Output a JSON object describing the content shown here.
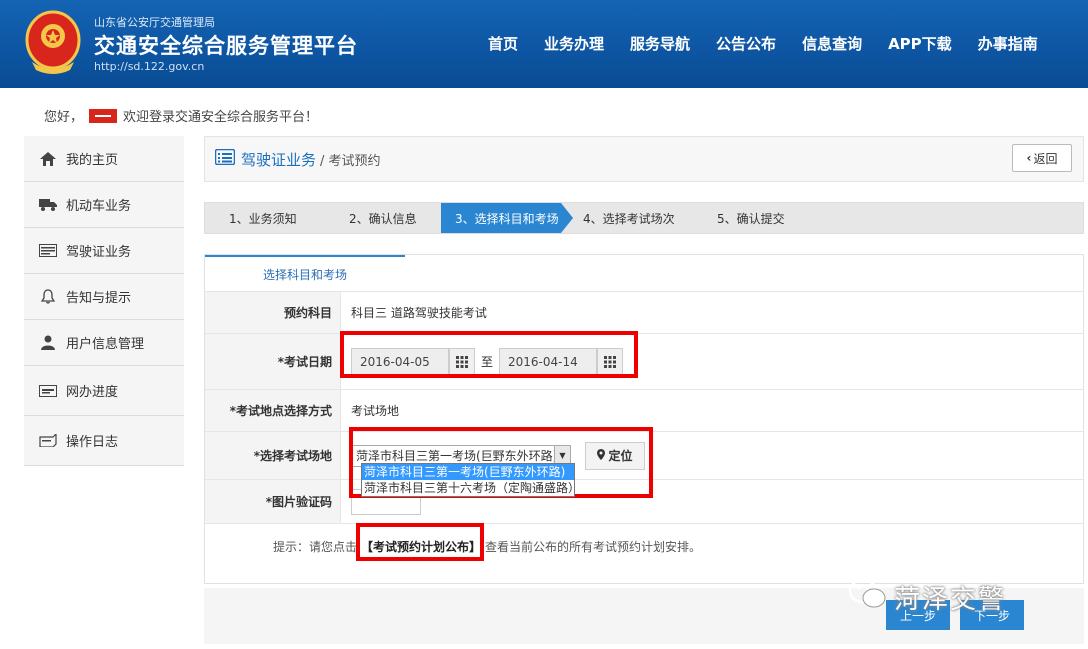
{
  "header": {
    "org": "山东省公安厅交通管理局",
    "title": "交通安全综合服务管理平台",
    "url": "http://sd.122.gov.cn",
    "nav": [
      "首页",
      "业务办理",
      "服务导航",
      "公告公布",
      "信息查询",
      "APP下载",
      "办事指南"
    ]
  },
  "greeting": {
    "prefix": "您好，",
    "suffix": "欢迎登录交通安全综合服务平台！"
  },
  "sidebar": {
    "items": [
      {
        "label": "我的主页",
        "icon": "home-icon"
      },
      {
        "label": "机动车业务",
        "icon": "truck-icon"
      },
      {
        "label": "驾驶证业务",
        "icon": "license-card-icon"
      },
      {
        "label": "告知与提示",
        "icon": "bell-icon"
      },
      {
        "label": "用户信息管理",
        "icon": "user-icon"
      },
      {
        "label": "网办进度",
        "icon": "progress-icon"
      },
      {
        "label": "操作日志",
        "icon": "log-icon"
      }
    ]
  },
  "breadcrumb": {
    "main": "驾驶证业务",
    "sub": "/ 考试预约",
    "back_label": "返回"
  },
  "steps": [
    {
      "label": "1、业务须知",
      "active": false
    },
    {
      "label": "2、确认信息",
      "active": false
    },
    {
      "label": "3、选择科目和考场",
      "active": true
    },
    {
      "label": "4、选择考试场次",
      "active": false
    },
    {
      "label": "5、确认提交",
      "active": false
    }
  ],
  "form": {
    "tab": "选择科目和考场",
    "subject_label": "预约科目",
    "subject_value": "科目三 道路驾驶技能考试",
    "date_label": "*考试日期",
    "date_from": "2016-04-05",
    "date_to_text": "至",
    "date_to": "2016-04-14",
    "method_label": "*考试地点选择方式",
    "method_value": "考试场地",
    "venue_label": "*选择考试场地",
    "venue_selected": "菏泽市科目三第一考场(巨野东外环路)",
    "venue_options": [
      "菏泽市科目三第一考场(巨野东外环路)",
      "菏泽市科目三第十六考场（定陶通盛路）"
    ],
    "locate_label": "定位",
    "captcha_label": "*图片验证码"
  },
  "hint": {
    "prefix": "提示：请您点击",
    "link": "【考试预约计划公布】",
    "suffix": "查看当前公布的所有考试预约计划安排。"
  },
  "buttons": {
    "prev": "上一步",
    "next": "下一步"
  },
  "watermark": "菏泽交警",
  "colors": {
    "header_blue": "#0d55a2",
    "accent_blue": "#2b86d1",
    "highlight_red": "#e00000"
  }
}
